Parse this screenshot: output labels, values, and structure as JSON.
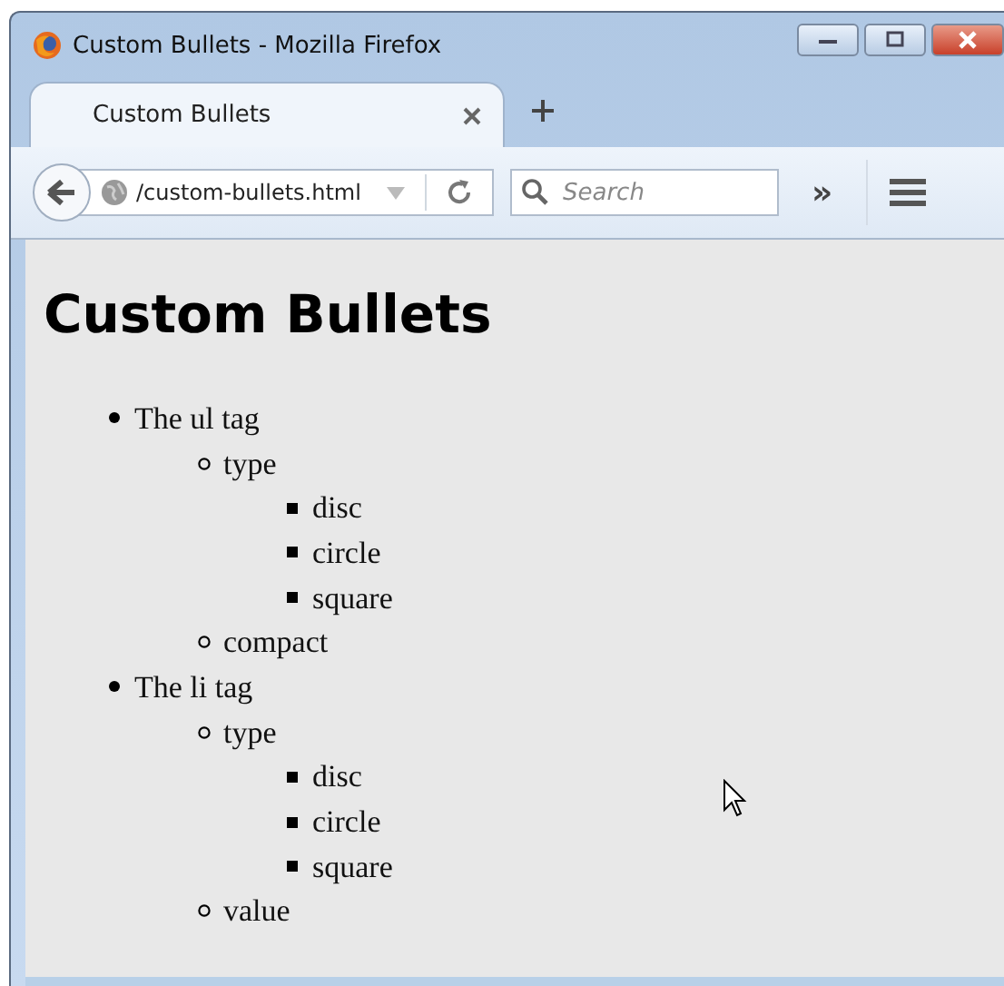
{
  "window": {
    "title": "Custom Bullets - Mozilla Firefox"
  },
  "tabs": [
    {
      "label": "Custom Bullets",
      "selected": true
    }
  ],
  "toolbar": {
    "url": "/custom-bullets.html",
    "search": {
      "placeholder": "Search"
    },
    "overflow": "»"
  },
  "page": {
    "heading": "Custom Bullets",
    "list": [
      {
        "label": "The ul tag",
        "kind": "disc",
        "children": [
          {
            "label": "type",
            "kind": "circle",
            "children": [
              {
                "label": "disc",
                "kind": "square"
              },
              {
                "label": "circle",
                "kind": "square"
              },
              {
                "label": "square",
                "kind": "square"
              }
            ]
          },
          {
            "label": "compact",
            "kind": "circle"
          }
        ]
      },
      {
        "label": "The li tag",
        "kind": "disc",
        "children": [
          {
            "label": "type",
            "kind": "circle",
            "children": [
              {
                "label": "disc",
                "kind": "square"
              },
              {
                "label": "circle",
                "kind": "square"
              },
              {
                "label": "square",
                "kind": "square"
              }
            ]
          },
          {
            "label": "value",
            "kind": "circle"
          }
        ]
      }
    ]
  }
}
